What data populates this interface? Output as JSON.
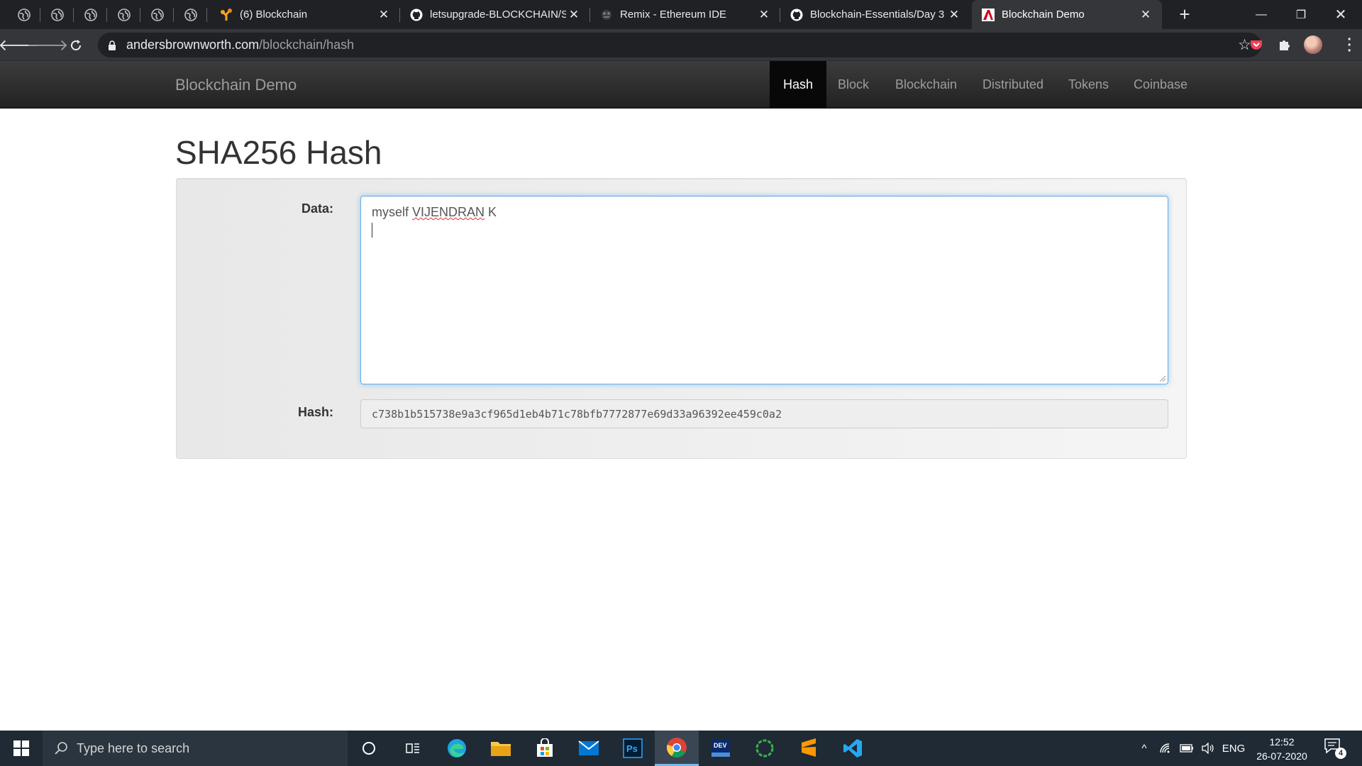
{
  "browser": {
    "tabs": [
      {
        "title": "(6) Blockchain",
        "icon": "blockchain-tree-icon"
      },
      {
        "title": "letsupgrade-BLOCKCHAIN/S",
        "icon": "github-icon"
      },
      {
        "title": "Remix - Ethereum IDE",
        "icon": "remix-icon"
      },
      {
        "title": "Blockchain-Essentials/Day 3",
        "icon": "github-icon"
      },
      {
        "title": "Blockchain Demo",
        "icon": "site-logo-icon",
        "active": true
      }
    ],
    "url_host": "andersbrownworth.com",
    "url_path": "/blockchain/hash"
  },
  "site": {
    "brand": "Blockchain Demo",
    "nav": [
      {
        "label": "Hash",
        "active": true
      },
      {
        "label": "Block"
      },
      {
        "label": "Blockchain"
      },
      {
        "label": "Distributed"
      },
      {
        "label": "Tokens"
      },
      {
        "label": "Coinbase"
      }
    ]
  },
  "page": {
    "title": "SHA256 Hash",
    "data_label": "Data:",
    "data_value_prefix": "myself ",
    "data_value_misspelled": "VIJENDRAN",
    "data_value_suffix": " K",
    "hash_label": "Hash:",
    "hash_value": "c738b1b515738e9a3cf965d1eb4b71c78bfb7772877e69d33a96392ee459c0a2"
  },
  "taskbar": {
    "search_placeholder": "Type here to search",
    "language": "ENG",
    "time": "12:52",
    "date": "26-07-2020",
    "notification_count": "4"
  },
  "colors": {
    "navbar_active": "#080808",
    "focus_border": "#66afe9",
    "chrome_dark": "#202124"
  }
}
